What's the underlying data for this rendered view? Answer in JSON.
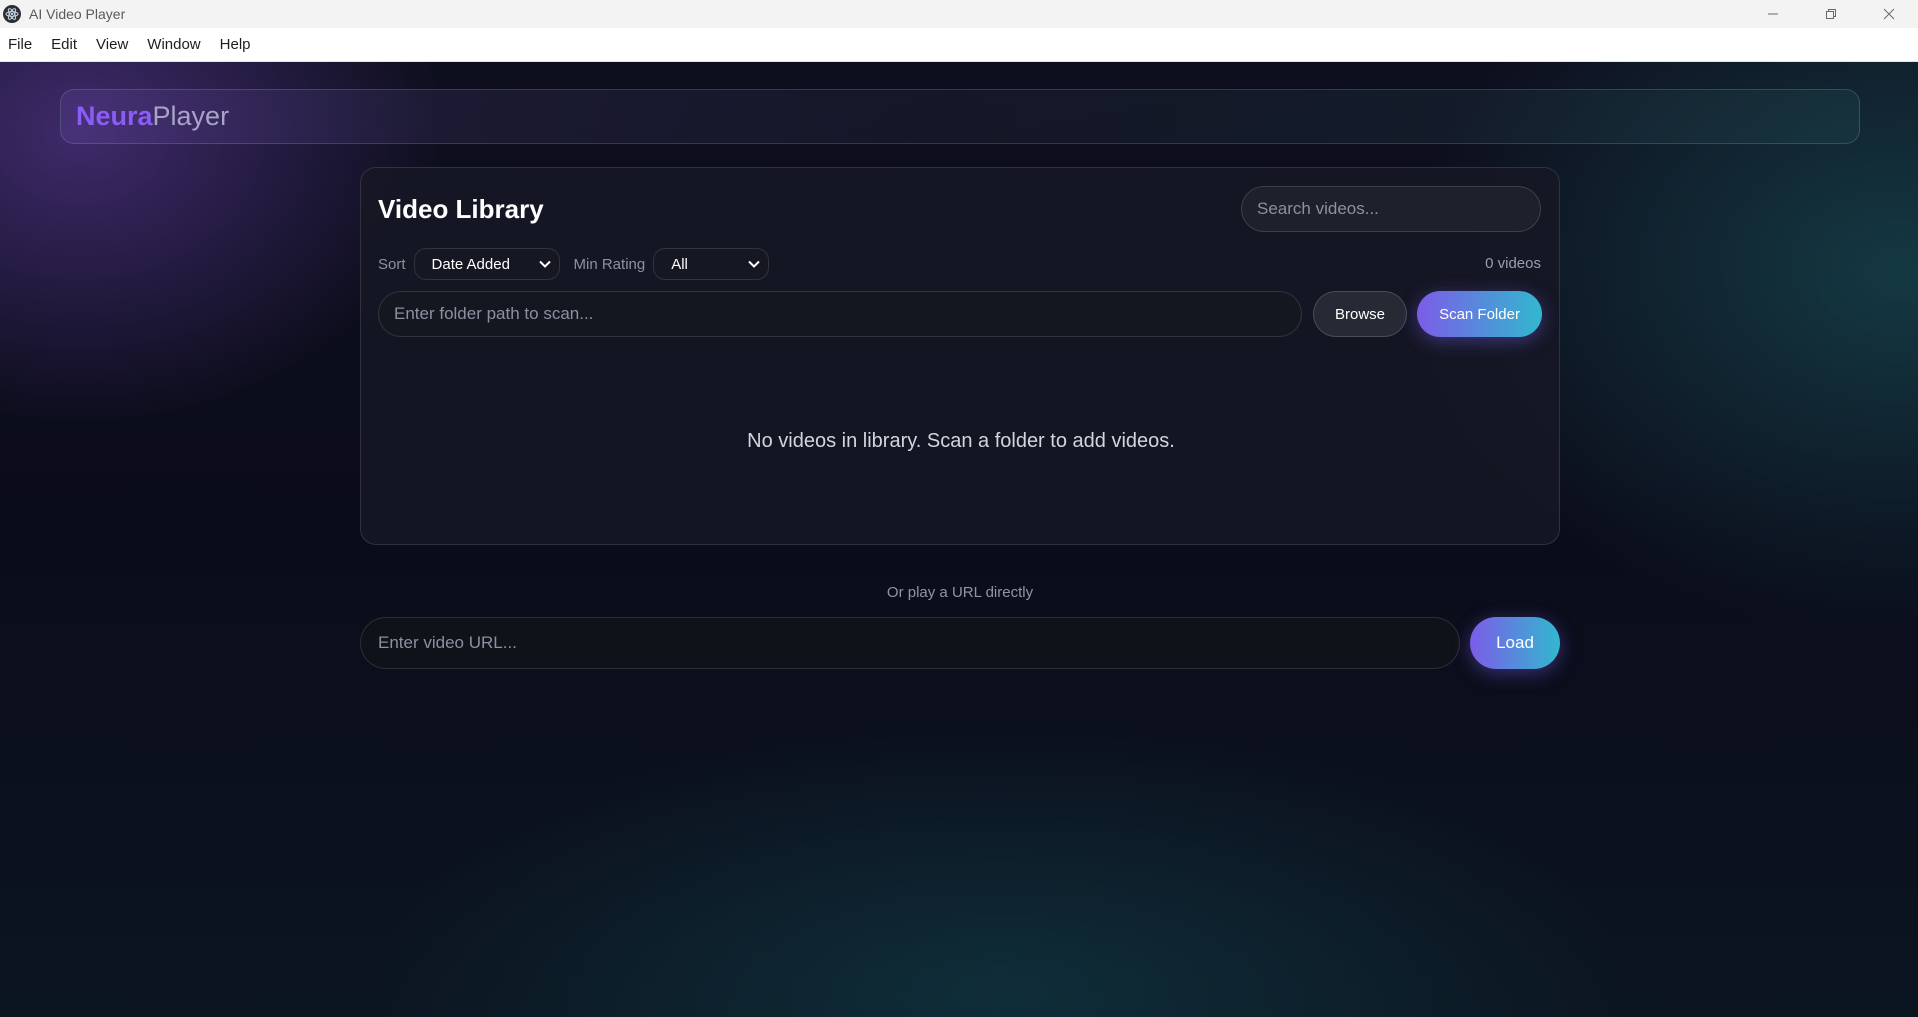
{
  "window": {
    "title": "AI Video Player",
    "icon": "electron-atom-icon"
  },
  "menu": {
    "items": [
      "File",
      "Edit",
      "View",
      "Window",
      "Help"
    ]
  },
  "header": {
    "brand_primary": "Neura",
    "brand_secondary": "Player"
  },
  "library": {
    "title": "Video Library",
    "search_placeholder": "Search videos...",
    "sort_label": "Sort",
    "sort_value": "Date Added",
    "rating_label": "Min Rating",
    "rating_value": "All",
    "count_text": "0 videos",
    "folder_placeholder": "Enter folder path to scan...",
    "browse_label": "Browse",
    "scan_label": "Scan Folder",
    "empty_message": "No videos in library. Scan a folder to add videos."
  },
  "url_section": {
    "label": "Or play a URL directly",
    "placeholder": "Enter video URL...",
    "load_label": "Load"
  },
  "colors": {
    "accent_purple": "#8b5cf6",
    "gradient_start": "#7c5ce8",
    "gradient_end": "#31b8cf"
  }
}
